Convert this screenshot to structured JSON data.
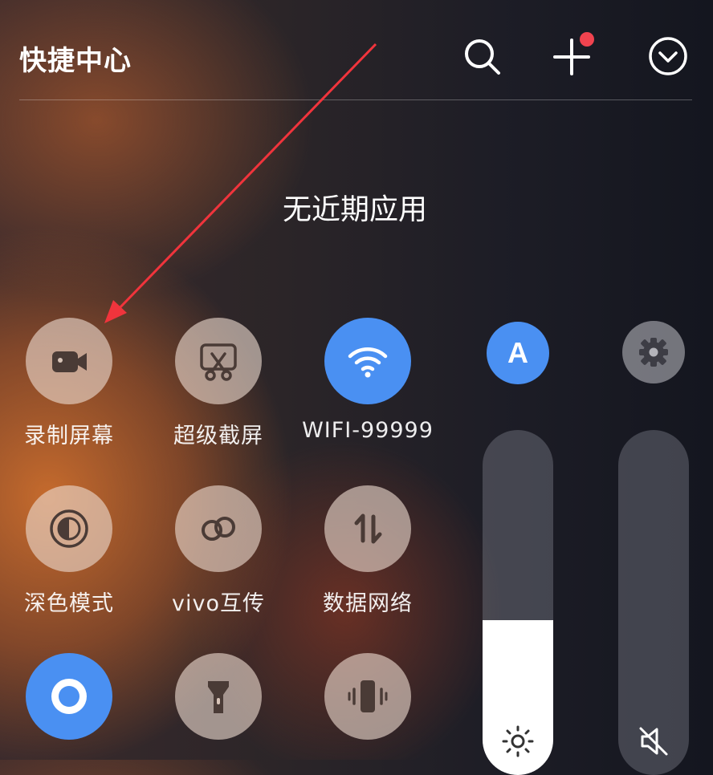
{
  "header": {
    "title": "快捷中心",
    "icons": [
      "search-icon",
      "add-icon",
      "collapse-icon"
    ],
    "has_notification_dot": true
  },
  "recent": {
    "empty_text": "无近期应用"
  },
  "tiles": [
    {
      "label": "录制屏幕",
      "icon": "video-record-icon",
      "active": false
    },
    {
      "label": "超级截屏",
      "icon": "super-screenshot-icon",
      "active": false
    },
    {
      "label": "WIFI-99999",
      "icon": "wifi-icon",
      "active": true
    },
    {
      "label": "深色模式",
      "icon": "dark-mode-icon",
      "active": false
    },
    {
      "label": "vivo互传",
      "icon": "vivo-share-icon",
      "active": false
    },
    {
      "label": "数据网络",
      "icon": "mobile-data-icon",
      "active": false
    },
    {
      "label": "",
      "icon": "eye-protection-icon",
      "active": true
    },
    {
      "label": "",
      "icon": "flashlight-icon",
      "active": false
    },
    {
      "label": "",
      "icon": "vibrate-icon",
      "active": false
    }
  ],
  "controls": {
    "auto_brightness": {
      "icon": "auto-brightness-icon",
      "glyph": "A",
      "active": true
    },
    "settings": {
      "icon": "settings-gear-icon",
      "active": false
    },
    "brightness_slider": {
      "icon": "brightness-sun-icon",
      "level": 0.45
    },
    "volume_slider": {
      "icon": "mute-icon",
      "level": 0.0
    }
  },
  "colors": {
    "accent": "#4a90f2",
    "notification_dot": "#f0434f",
    "annotation_arrow": "#f0343c"
  }
}
